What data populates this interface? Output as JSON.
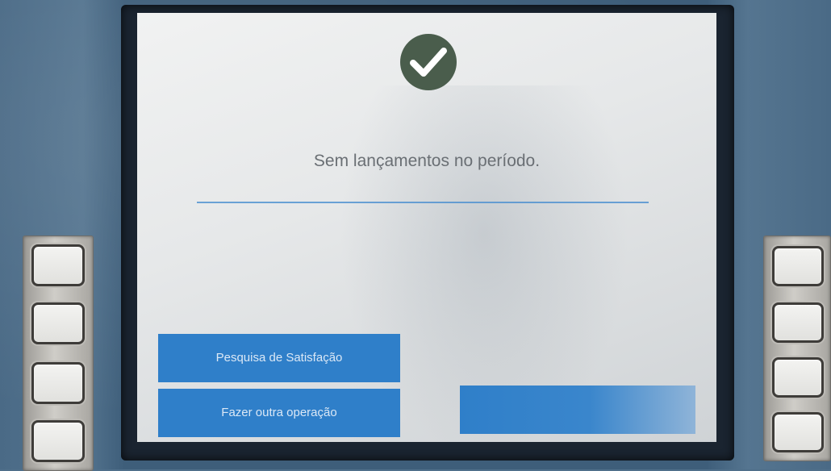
{
  "screen": {
    "message": "Sem lançamentos no período.",
    "icon": "check-circle-icon",
    "colors": {
      "icon_circle": "#4a5d4c",
      "button": "#2f7fc9",
      "divider": "#4a8fd0"
    }
  },
  "buttons": {
    "survey_label": "Pesquisa de Satisfação",
    "other_operation_label": "Fazer outra operação",
    "right_bottom_label": ""
  },
  "side_keys": {
    "left": [
      "",
      "",
      "",
      ""
    ],
    "right": [
      "",
      "",
      "",
      ""
    ]
  }
}
